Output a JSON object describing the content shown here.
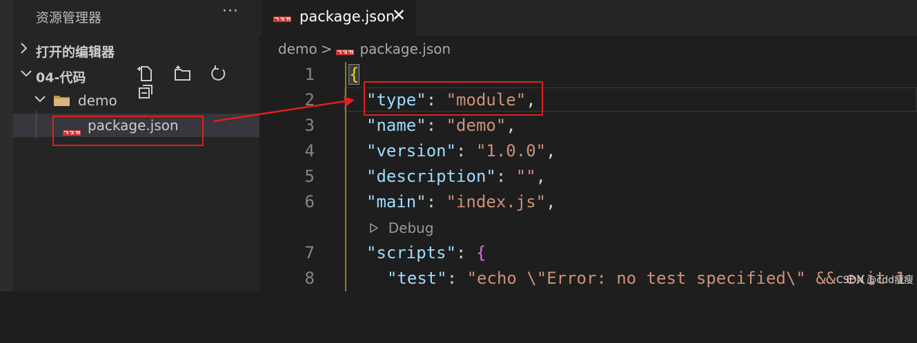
{
  "sidebar": {
    "title": "资源管理器",
    "more_label": "···",
    "open_editors_label": "打开的编辑器",
    "root_folder_label": "04-代码",
    "folder_label": "demo",
    "file_label": "package.json"
  },
  "tab": {
    "label": "package.json",
    "close_label": "✕"
  },
  "breadcrumb": {
    "folder": "demo",
    "separator": ">",
    "file": "package.json"
  },
  "code": {
    "line_numbers": [
      "1",
      "2",
      "3",
      "4",
      "5",
      "6",
      "7",
      "8"
    ],
    "lines": [
      {
        "brace": "{"
      },
      {
        "key": "\"type\"",
        "colon": ": ",
        "value": "\"module\"",
        "comma": ","
      },
      {
        "key": "\"name\"",
        "colon": ": ",
        "value": "\"demo\"",
        "comma": ","
      },
      {
        "key": "\"version\"",
        "colon": ": ",
        "value": "\"1.0.0\"",
        "comma": ","
      },
      {
        "key": "\"description\"",
        "colon": ": ",
        "value": "\"\"",
        "comma": ","
      },
      {
        "key": "\"main\"",
        "colon": ": ",
        "value": "\"index.js\"",
        "comma": ","
      },
      {
        "key": "\"scripts\"",
        "colon": ": ",
        "brace": "{"
      },
      {
        "key": "\"test\"",
        "colon": ": ",
        "value": "\"echo \\\"Error: no test specified\\\" && exit 1"
      }
    ],
    "codelens": "Debug"
  },
  "watermark": "CSDN @cdd瘦瘦",
  "colors": {
    "annotation": "#e02020",
    "json_key": "#9cdcfe",
    "json_string": "#ce9178",
    "bracket": "#ffd700",
    "npm_icon": "#cb3837"
  },
  "icons": [
    "chevron-right-icon",
    "chevron-down-icon",
    "new-file-icon",
    "new-folder-icon",
    "refresh-icon",
    "collapse-all-icon",
    "folder-icon",
    "npm-icon",
    "close-icon",
    "play-icon"
  ]
}
